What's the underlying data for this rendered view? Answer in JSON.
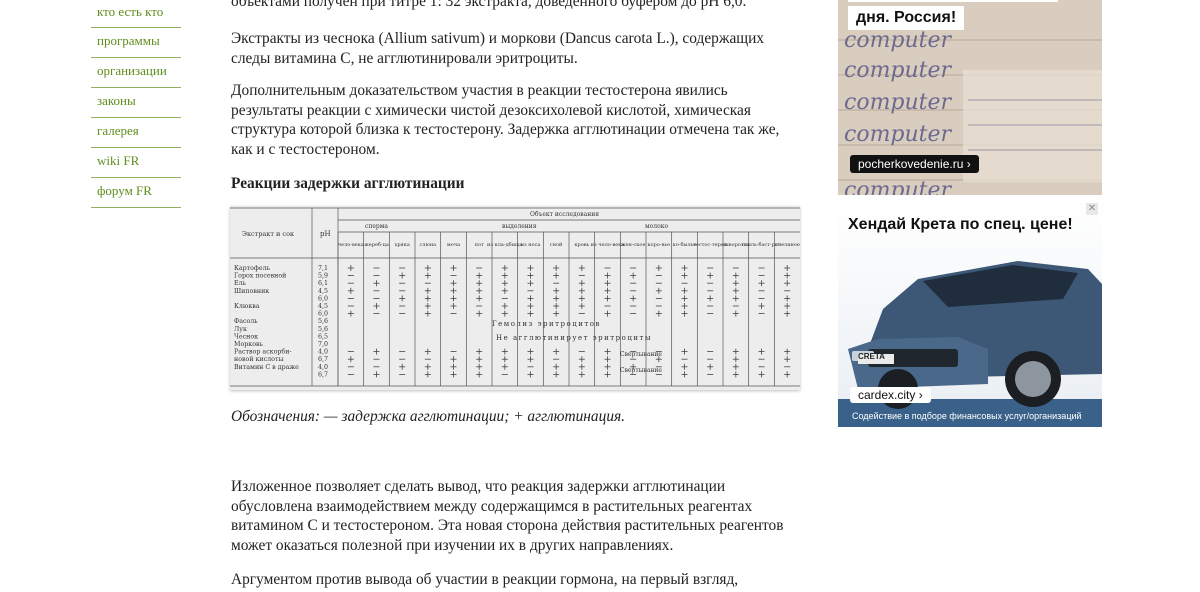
{
  "nav": {
    "items": [
      {
        "label": "кто есть кто"
      },
      {
        "label": "программы"
      },
      {
        "label": "организации"
      },
      {
        "label": "законы"
      },
      {
        "label": "галерея"
      },
      {
        "label": "wiki FR"
      },
      {
        "label": "форум FR"
      }
    ]
  },
  "article": {
    "top_fragment": "объектами получен при титре 1: 32 экстракта, доведенного буфером до pH 6,0.",
    "p1": "Экстракты из чеснока (Allium sativum) и моркови (Dancus carota L.), содержащих следы витамина С, не агглютинировали эритроциты.",
    "p2": "Дополнительным доказательством участия в реакции тестостерона явились результаты реакции с химически чистой дезоксихолевой кислотой, химическая структура которой близка к тестостерону. Задержка агглютинации отмечена так же, как и с тестостероном.",
    "heading": "Реакции задержки агглютинации",
    "legend": "Обозначения: — задержка агглютинации; + агглютинация.",
    "p4": "Изложенное позволяет сделать вывод, что реакция задержки агглютинации обусловлена взаимодействием между содержащимся в растительных реагентах витамином С и тестостероном. Эта новая сторона действия растительных реагентов может оказаться полезной при изучении их в других направлениях.",
    "p5": "Аргументом против вывода об участии в реакции гормона, на первый взгляд,"
  },
  "scan_table": {
    "col_extract": "Экстракт и сок",
    "col_ph": "pH",
    "col_group": "Объект исследования",
    "group_sperm": "сперма",
    "group_secretions": "выделения",
    "group_milk": "молоко",
    "subcols": [
      "чело-века",
      "жереб-ца",
      "хряка",
      "слюна",
      "моча",
      "пот",
      "из кла-дбища",
      "из носа",
      "гной",
      "кровь",
      "из чело-века",
      "жен-ское",
      "коро-вье",
      "ко-былье",
      "тестос-терон",
      "сыворотка",
      "стиль-бэст-рол",
      "пчелиное"
    ],
    "rows": [
      {
        "name": "Картофель",
        "ph": "7,1"
      },
      {
        "name": "Горох посевной",
        "ph": "5,9"
      },
      {
        "name": "Ель",
        "ph": "6,1"
      },
      {
        "name": "Шиповник",
        "ph": "4,5"
      },
      {
        "name": "",
        "ph": "6,0"
      },
      {
        "name": "Клюква",
        "ph": "4,5"
      },
      {
        "name": "",
        "ph": "6,0"
      },
      {
        "name": "Фасоль",
        "ph": "5,6"
      },
      {
        "name": "Лук",
        "ph": "5,6"
      },
      {
        "name": "Чеснок",
        "ph": "6,5"
      },
      {
        "name": "Морковь",
        "ph": "7,0"
      },
      {
        "name": "Раствор аскорби-",
        "ph": "4,0"
      },
      {
        "name": "новой кислоты",
        "ph": "6,7"
      },
      {
        "name": "Витамин С в драже",
        "ph": "4,0"
      },
      {
        "name": "",
        "ph": "6,7"
      }
    ],
    "note_hemolysis": "Гемолиз эритроцитов",
    "note_no_agg": "Не агглютинирует эритроциты",
    "note_clot1": "Свертывание",
    "note_clot2": "Свертывание"
  },
  "ads": {
    "ad1_title": "дня. Россия!",
    "ad1_url": "pocherkovedenie.ru",
    "ad1_handwriting": [
      "computer",
      "computer",
      "computer",
      "computer",
      "computer"
    ],
    "ad2_title": "Хендай Крета по спец. цене!",
    "ad2_url": "cardex.city",
    "ad2_disclaimer": "Содействие в подборе финансовых услуг/организаций",
    "ad2_badge": "CRETA",
    "ad2_close": "✕"
  },
  "colors": {
    "nav_link": "#5f8d1d",
    "nav_border": "#8fb15a"
  }
}
